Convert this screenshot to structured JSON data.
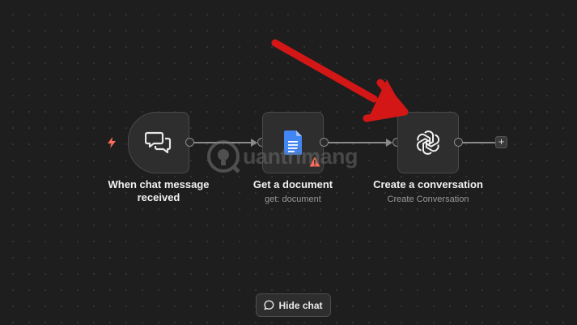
{
  "canvas": {
    "accent_arrow_color": "#d31616",
    "trigger_color": "#ff6d5a",
    "warning_color": "#ff6d5a"
  },
  "nodes": [
    {
      "title": "When chat message received",
      "title_line1": "When chat message",
      "title_line2": "received",
      "subtitle": "",
      "icon": "chat-bubbles-icon"
    },
    {
      "title": "Get a document",
      "subtitle": "get: document",
      "icon": "google-docs-icon"
    },
    {
      "title": "Create a conversation",
      "subtitle": "Create Conversation",
      "icon": "openai-icon"
    }
  ],
  "add_node": {
    "label": "+"
  },
  "hide_chat": {
    "label": "Hide chat",
    "icon": "chat-bubble-icon"
  },
  "watermark": {
    "text": "uantrimang"
  }
}
